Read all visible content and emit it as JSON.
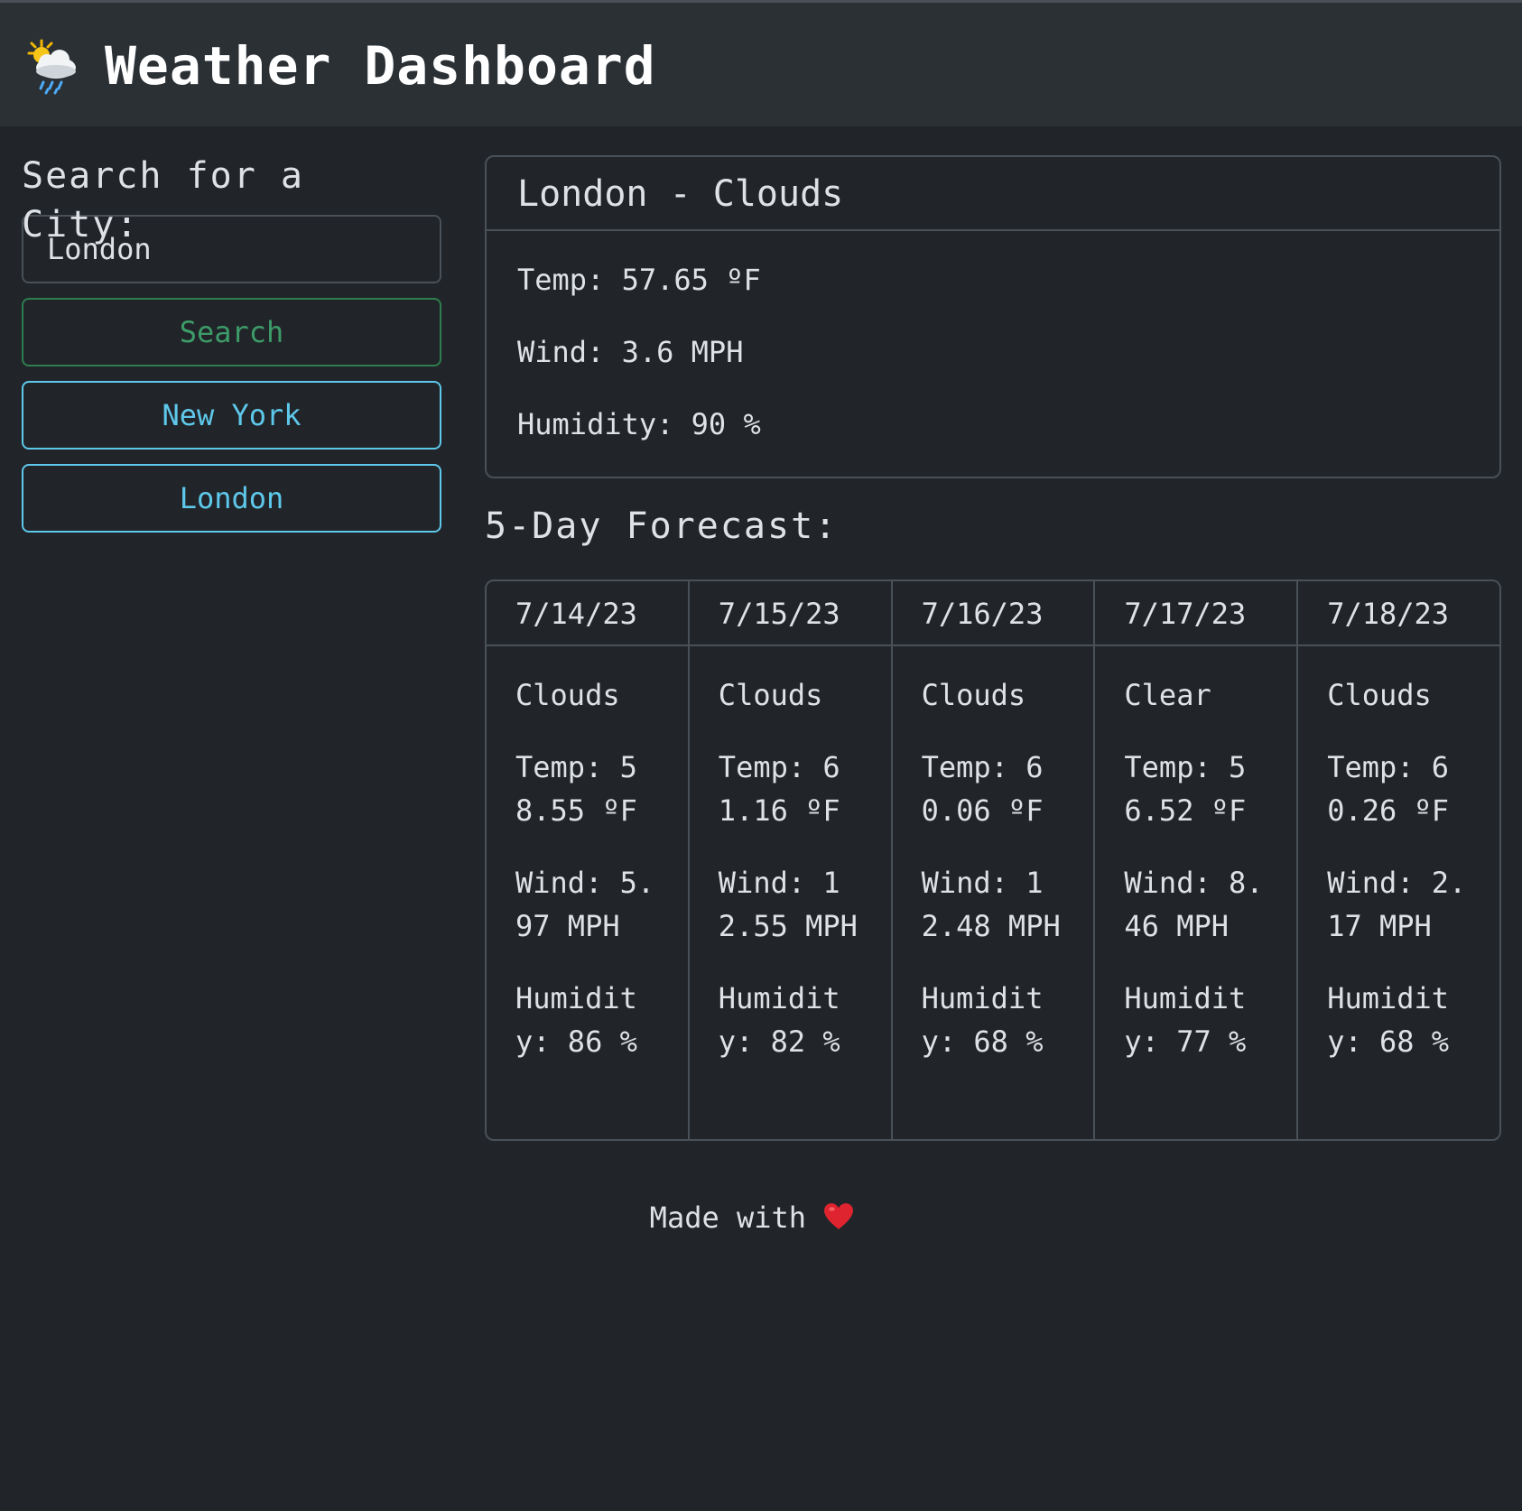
{
  "header": {
    "logo_icon": "sun-behind-rain-cloud-icon",
    "title": "Weather Dashboard"
  },
  "sidebar": {
    "heading": "Search for a City:",
    "search_input": {
      "value": "London",
      "placeholder": ""
    },
    "search_button_label": "Search",
    "history": [
      {
        "label": "New York"
      },
      {
        "label": "London"
      }
    ]
  },
  "current": {
    "title": "London - Clouds",
    "temp": "Temp: 57.65 ºF",
    "wind": "Wind: 3.6 MPH",
    "humidity": "Humidity: 90 %"
  },
  "forecast": {
    "heading": "5-Day Forecast:",
    "days": [
      {
        "date": "7/14/23",
        "condition": "Clouds",
        "temp": "Temp: 58.55 ºF",
        "wind": "Wind: 5.97 MPH",
        "humidity": "Humidity: 86 %"
      },
      {
        "date": "7/15/23",
        "condition": "Clouds",
        "temp": "Temp: 61.16 ºF",
        "wind": "Wind: 12.55 MPH",
        "humidity": "Humidity: 82 %"
      },
      {
        "date": "7/16/23",
        "condition": "Clouds",
        "temp": "Temp: 60.06 ºF",
        "wind": "Wind: 12.48 MPH",
        "humidity": "Humidity: 68 %"
      },
      {
        "date": "7/17/23",
        "condition": "Clear",
        "temp": "Temp: 56.52 ºF",
        "wind": "Wind: 8.46 MPH",
        "humidity": "Humidity: 77 %"
      },
      {
        "date": "7/18/23",
        "condition": "Clouds",
        "temp": "Temp: 60.26 ºF",
        "wind": "Wind: 2.17 MPH",
        "humidity": "Humidity: 68 %"
      }
    ]
  },
  "footer": {
    "text": "Made with",
    "icon": "heart-icon"
  },
  "colors": {
    "background": "#212529",
    "topbar": "#2b3035",
    "border": "#495057",
    "text": "#dee2e6",
    "search_green": "#3d9b68",
    "city_blue": "#5ec8eb",
    "heart_red": "#e0242f"
  }
}
